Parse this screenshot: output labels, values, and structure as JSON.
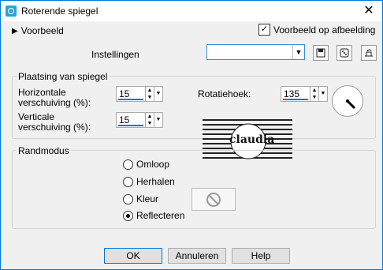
{
  "window": {
    "title": "Roterende spiegel",
    "close_glyph": "✕"
  },
  "top": {
    "preview_toggle_label": "Voorbeeld",
    "preview_on_image_label": "Voorbeeld op afbeelding",
    "preview_on_image_checked": true
  },
  "settings": {
    "label": "Instellingen",
    "combo_value": ""
  },
  "toolbar_icons": [
    "save-icon",
    "dice-icon",
    "reset-icon"
  ],
  "placement": {
    "title": "Plaatsing van spiegel",
    "horizontal_label_1": "Horizontale",
    "horizontal_label_2": "verschuiving (%):",
    "horizontal_value": "15",
    "vertical_label_1": "Verticale",
    "vertical_label_2": "verschuiving (%):",
    "vertical_value": "15",
    "rotation_label": "Rotatiehoek:",
    "rotation_value": "135"
  },
  "watermark": {
    "text": "claudia"
  },
  "edge_mode": {
    "title": "Randmodus",
    "options": [
      "Omloop",
      "Herhalen",
      "Kleur",
      "Reflecteren"
    ],
    "selected": "Reflecteren"
  },
  "buttons": {
    "ok": "OK",
    "cancel": "Annuleren",
    "help": "Help"
  },
  "colors": {
    "accent": "#0078d7",
    "spin_bar": "#1a6fd1"
  }
}
